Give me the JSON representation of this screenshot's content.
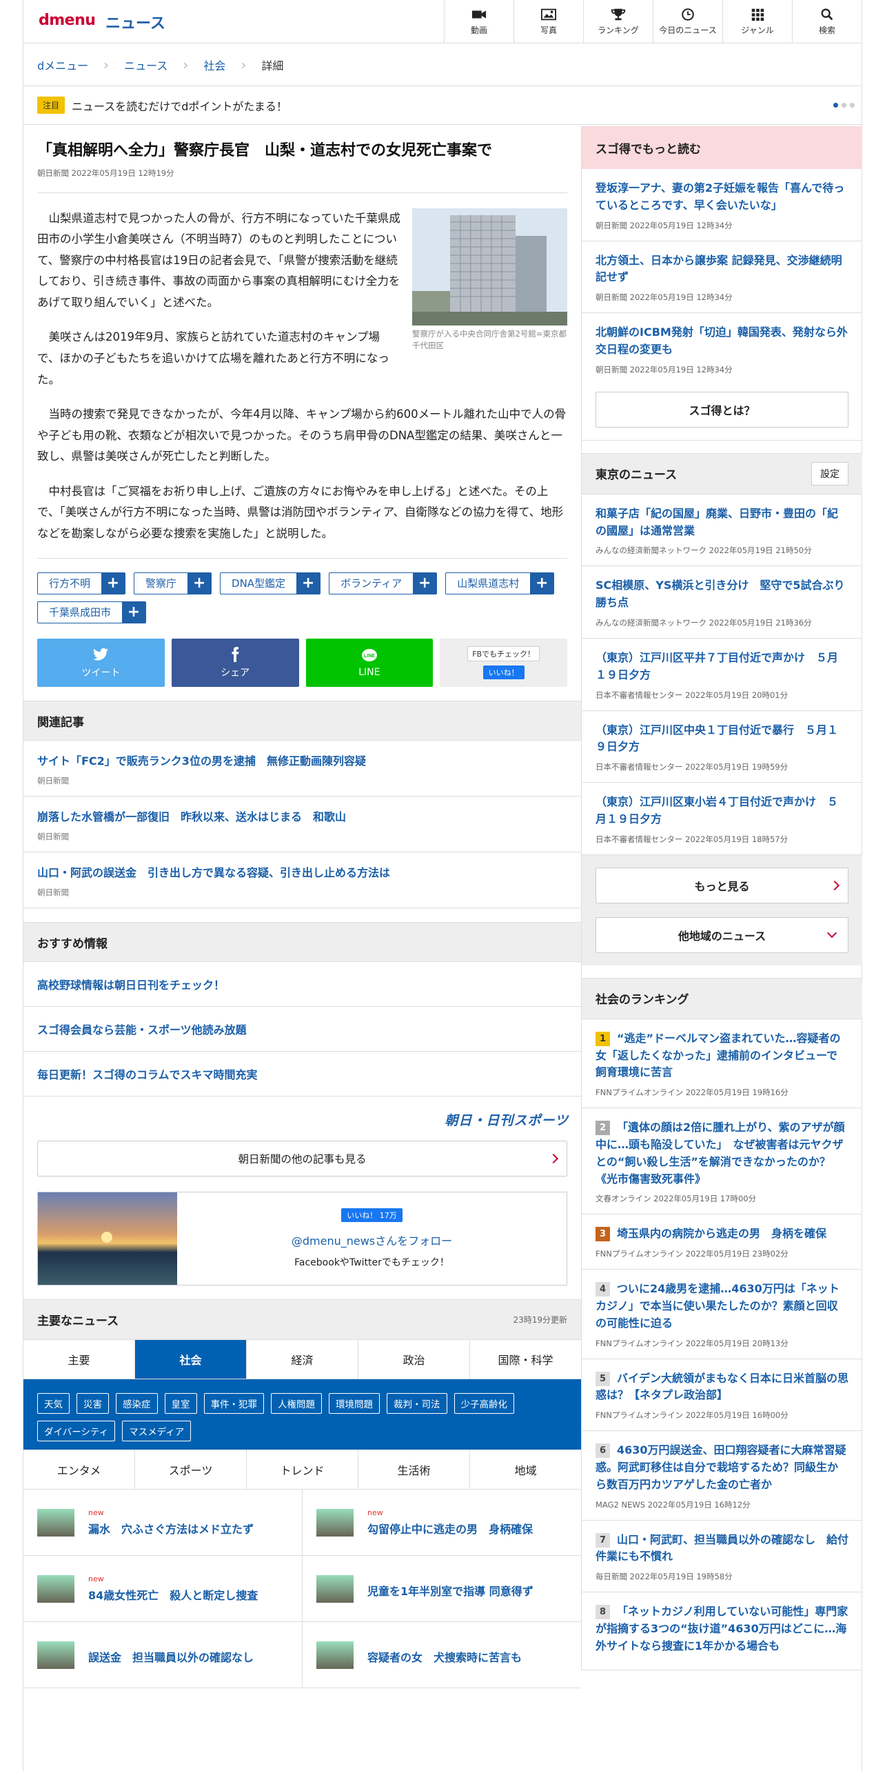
{
  "header": {
    "logo_main": "dmenu",
    "logo_sub": "ニュース",
    "nav": [
      {
        "label": "動画",
        "icon": "video-icon"
      },
      {
        "label": "写真",
        "icon": "photo-icon"
      },
      {
        "label": "ランキング",
        "icon": "trophy-icon"
      },
      {
        "label": "今日のニュース",
        "icon": "clock-icon"
      },
      {
        "label": "ジャンル",
        "icon": "grid-icon"
      },
      {
        "label": "検索",
        "icon": "search-icon"
      }
    ]
  },
  "breadcrumb": [
    "dメニュー",
    "ニュース",
    "社会",
    "詳細"
  ],
  "notice": {
    "badge": "注目",
    "text": "ニュースを読むだけでdポイントがたまる！"
  },
  "article": {
    "title": "「真相解明へ全力」警察庁長官　山梨・道志村での女児死亡事案で",
    "meta": "朝日新聞 2022年05月19日 12時19分",
    "photo_caption": "警察庁が入る中央合同庁舎第2号館=東京都千代田区",
    "paragraphs": [
      "山梨県道志村で見つかった人の骨が、行方不明になっていた千葉県成田市の小学生小倉美咲さん（不明当時7）のものと判明したことについて、警察庁の中村格長官は19日の記者会見で、「県警が捜索活動を継続しており、引き続き事件、事故の両面から事案の真相解明にむけ全力をあげて取り組んでいく」と述べた。",
      "美咲さんは2019年9月、家族らと訪れていた道志村のキャンプ場で、ほかの子どもたちを追いかけて広場を離れたあと行方不明になった。",
      "当時の捜索で発見できなかったが、今年4月以降、キャンプ場から約600メートル離れた山中で人の骨や子ども用の靴、衣類などが相次いで見つかった。そのうち肩甲骨のDNA型鑑定の結果、美咲さんと一致し、県警は美咲さんが死亡したと判断した。",
      "中村長官は「ご冥福をお祈り申し上げ、ご遺族の方々にお悔やみを申し上げる」と述べた。その上で、「美咲さんが行方不明になった当時、県警は消防団やボランティア、自衛隊などの協力を得て、地形などを勘案しながら必要な捜索を実施した」と説明した。"
    ],
    "tags": [
      "行方不明",
      "警察庁",
      "DNA型鑑定",
      "ボランティア",
      "山梨県道志村",
      "千葉県成田市"
    ],
    "tag_plus": "+"
  },
  "share": {
    "tweet": "ツイート",
    "share": "シェア",
    "line": "LINE",
    "fb_check": "FBでもチェック！",
    "like": "いいね！"
  },
  "related": {
    "heading": "関連記事",
    "items": [
      {
        "title": "サイト「FC2」で販売ランク3位の男を逮捕　無修正動画陳列容疑",
        "source": "朝日新聞"
      },
      {
        "title": "崩落した水管橋が一部復旧　昨秋以来、送水はじまる　和歌山",
        "source": "朝日新聞"
      },
      {
        "title": "山口・阿武の誤送金　引き出し方で異なる容疑、引き出し止める方法は",
        "source": "朝日新聞"
      }
    ]
  },
  "recommend": {
    "heading": "おすすめ情報",
    "items": [
      "高校野球情報は朝日日刊をチェック！",
      "スゴ得会員なら芸能・スポーツ他読み放題",
      "毎日更新！スゴ得のコラムでスキマ時間充実"
    ]
  },
  "asahi": {
    "logo": "朝日・日刊スポーツ",
    "more": "朝日新聞の他の記事も見る"
  },
  "follow": {
    "likes": "いいね！ 17万",
    "account": "@dmenu_newsさんをフォロー",
    "note": "FacebookやTwitterでもチェック！"
  },
  "main_news": {
    "heading": "主要なニュース",
    "updated": "23時19分更新",
    "tabs": [
      "主要",
      "社会",
      "経済",
      "政治",
      "国際・科学"
    ],
    "active_tab": "社会",
    "subtags": [
      "天気",
      "災害",
      "感染症",
      "皇室",
      "事件・犯罪",
      "人権問題",
      "環境問題",
      "裁判・司法",
      "少子高齢化",
      "ダイバーシティ",
      "マスメディア"
    ],
    "tabs2": [
      "エンタメ",
      "スポーツ",
      "トレンド",
      "生活術",
      "地域"
    ],
    "items": [
      {
        "new": "new",
        "title": "漏水　穴ふさぐ方法はメド立たず"
      },
      {
        "new": "new",
        "title": "勾留停止中に逃走の男　身柄確保"
      },
      {
        "new": "new",
        "title": "84歳女性死亡　殺人と断定し捜査"
      },
      {
        "new": "",
        "title": "児童を1年半別室で指導 同意得ず"
      },
      {
        "new": "",
        "title": "誤送金　担当職員以外の確認なし"
      },
      {
        "new": "",
        "title": "容疑者の女　犬捜索時に苦言も"
      }
    ]
  },
  "sidebar": {
    "sugotoku": {
      "heading": "スゴ得でもっと読む",
      "items": [
        {
          "title": "登坂淳一アナ、妻の第2子妊娠を報告「喜んで待っているところです、早く会いたいな」",
          "meta": "朝日新聞 2022年05月19日 12時34分"
        },
        {
          "title": "北方領土、日本から譲歩案 記録発見、交渉継続明記せず",
          "meta": "朝日新聞 2022年05月19日 12時34分"
        },
        {
          "title": "北朝鮮のICBM発射「切迫」韓国発表、発射なら外交日程の変更も",
          "meta": "朝日新聞 2022年05月19日 12時34分"
        }
      ],
      "button": "スゴ得とは？"
    },
    "tokyo": {
      "heading": "東京のニュース",
      "settings": "設定",
      "items": [
        {
          "title": "和菓子店「紀の国屋」廃業、日野市・豊田の「紀の國屋」は通常営業",
          "meta": "みんなの経済新聞ネットワーク 2022年05月19日 21時50分"
        },
        {
          "title": "SC相模原、YS横浜と引き分け　堅守で5試合ぶり勝ち点",
          "meta": "みんなの経済新聞ネットワーク 2022年05月19日 21時36分"
        },
        {
          "title": "（東京）江戸川区平井７丁目付近で声かけ　５月１９日夕方",
          "meta": "日本不審者情報センター 2022年05月19日 20時01分"
        },
        {
          "title": "（東京）江戸川区中央１丁目付近で暴行　５月１９日夕方",
          "meta": "日本不審者情報センター 2022年05月19日 19時59分"
        },
        {
          "title": "（東京）江戸川区東小岩４丁目付近で声かけ　５月１９日夕方",
          "meta": "日本不審者情報センター 2022年05月19日 18時57分"
        }
      ],
      "more": "もっと見る",
      "other": "他地域のニュース"
    },
    "ranking": {
      "heading": "社会のランキング",
      "items": [
        {
          "rank": "1",
          "title": "“逃走”ドーベルマン盗まれていた…容疑者の女「返したくなかった」逮捕前のインタビューで飼育環境に苦言",
          "meta": "FNNプライムオンライン 2022年05月19日 19時16分"
        },
        {
          "rank": "2",
          "title": "「遺体の顔は2倍に腫れ上がり、紫のアザが顔中に…頭も陥没していた」　なぜ被害者は元ヤクザとの“飼い殺し生活”を解消できなかったのか？《光市傷害致死事件》",
          "meta": "文春オンライン 2022年05月19日 17時00分"
        },
        {
          "rank": "3",
          "title": "埼玉県内の病院から逃走の男　身柄を確保",
          "meta": "FNNプライムオンライン 2022年05月19日 23時02分"
        },
        {
          "rank": "4",
          "title": "ついに24歳男を逮捕…4630万円は「ネットカジノ」で本当に使い果たしたのか？素顔と回収の可能性に迫る",
          "meta": "FNNプライムオンライン 2022年05月19日 20時13分"
        },
        {
          "rank": "5",
          "title": "バイデン大統領がまもなく日本に日米首脳の思惑は？【ネタプレ政治部】",
          "meta": "FNNプライムオンライン 2022年05月19日 16時00分"
        },
        {
          "rank": "6",
          "title": "4630万円誤送金、田口翔容疑者に大麻常習疑惑。阿武町移住は自分で栽培するため？同級生から数百万円カツアゲした金の亡者か",
          "meta": "MAG2 NEWS 2022年05月19日 16時12分"
        },
        {
          "rank": "7",
          "title": "山口・阿武町、担当職員以外の確認なし　給付件業にも不慣れ",
          "meta": "毎日新聞 2022年05月19日 19時58分"
        },
        {
          "rank": "8",
          "title": "「ネットカジノ利用していない可能性」専門家が指摘する3つの“抜け道”4630万円はどこに…海外サイトなら捜査に1年かかる場合も",
          "meta": ""
        }
      ]
    }
  }
}
